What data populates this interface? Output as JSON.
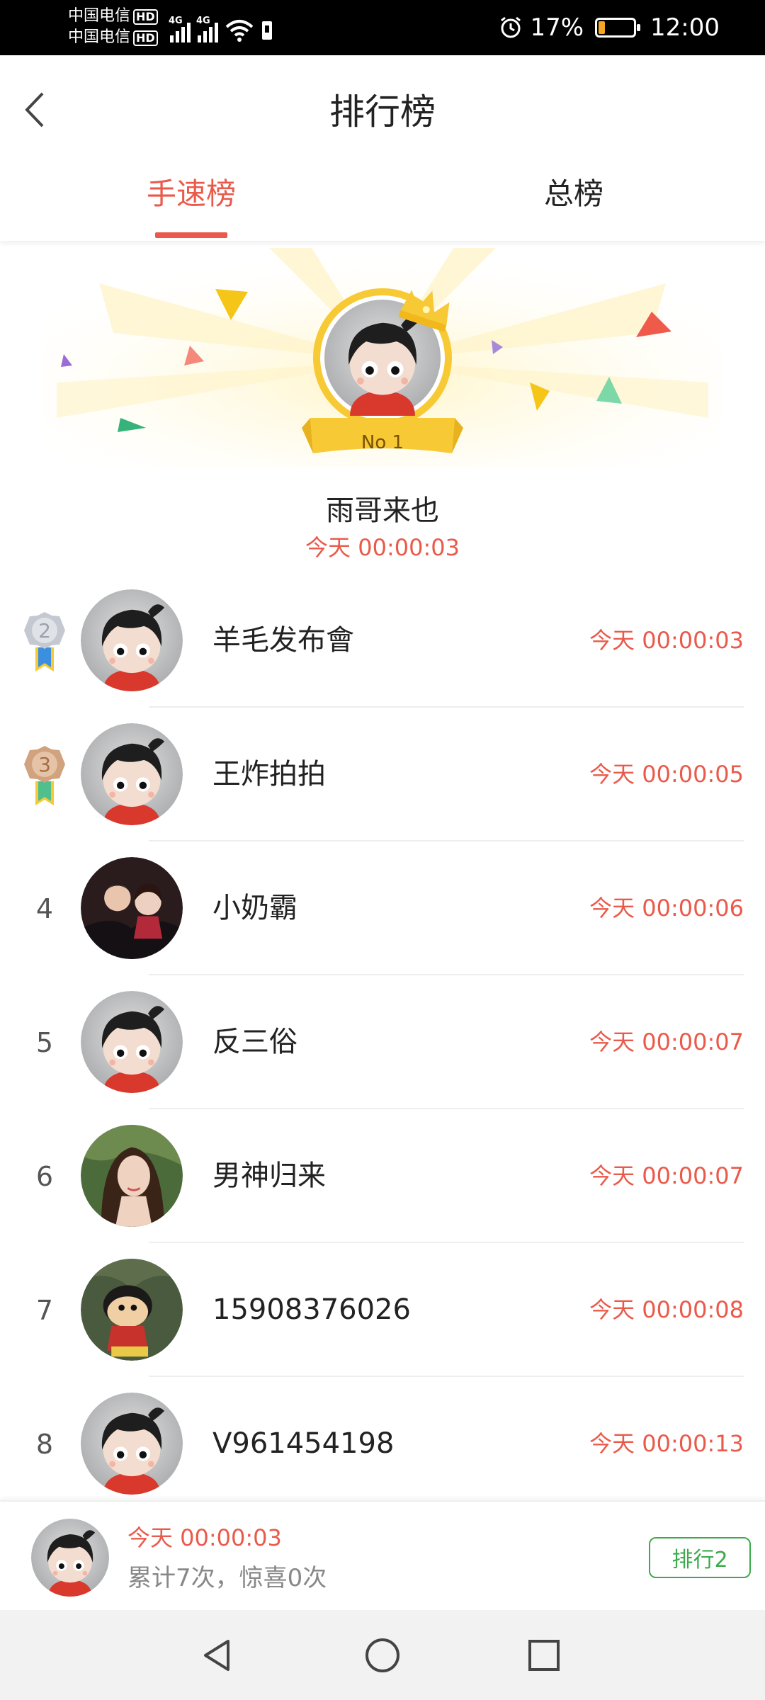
{
  "status_bar": {
    "carrier_1": "中国电信",
    "carrier_2": "中国电信",
    "hd_badge": "HD",
    "network_type": "4G",
    "alarm_icon": "alarm-icon",
    "battery_percent": "17%",
    "battery_level": 0.17,
    "time": "12:00"
  },
  "header": {
    "title": "排行榜",
    "back_icon": "chevron-left-icon"
  },
  "tabs": [
    {
      "label": "手速榜",
      "active": true
    },
    {
      "label": "总榜",
      "active": false
    }
  ],
  "colors": {
    "accent": "#ea5a4b",
    "gold": "#f2c21b",
    "green": "#3caa4a"
  },
  "champion": {
    "badge": "No 1",
    "name": "雨哥来也",
    "time": "今天 00:00:03"
  },
  "list": [
    {
      "rank": "2",
      "medal": "silver",
      "name": "羊毛发布會",
      "time": "今天 00:00:03",
      "avatar": "cartoon"
    },
    {
      "rank": "3",
      "medal": "bronze",
      "name": "王炸拍拍",
      "time": "今天 00:00:05",
      "avatar": "cartoon"
    },
    {
      "rank": "4",
      "name": "小奶霸",
      "time": "今天 00:00:06",
      "avatar": "photo-kids"
    },
    {
      "rank": "5",
      "name": "反三俗",
      "time": "今天 00:00:07",
      "avatar": "cartoon"
    },
    {
      "rank": "6",
      "name": "男神归来",
      "time": "今天 00:00:07",
      "avatar": "photo-woman"
    },
    {
      "rank": "7",
      "name": "15908376026",
      "time": "今天 00:00:08",
      "avatar": "photo-cartoon-boy"
    },
    {
      "rank": "8",
      "name": "V961454198",
      "time": "今天 00:00:13",
      "avatar": "cartoon"
    }
  ],
  "my_record": {
    "time": "今天 00:00:03",
    "stats": "累计7次，惊喜0次",
    "rank_button": "排行2"
  },
  "nav_bar": {
    "back_icon": "triangle-back-icon",
    "home_icon": "circle-home-icon",
    "recents_icon": "square-recents-icon"
  }
}
